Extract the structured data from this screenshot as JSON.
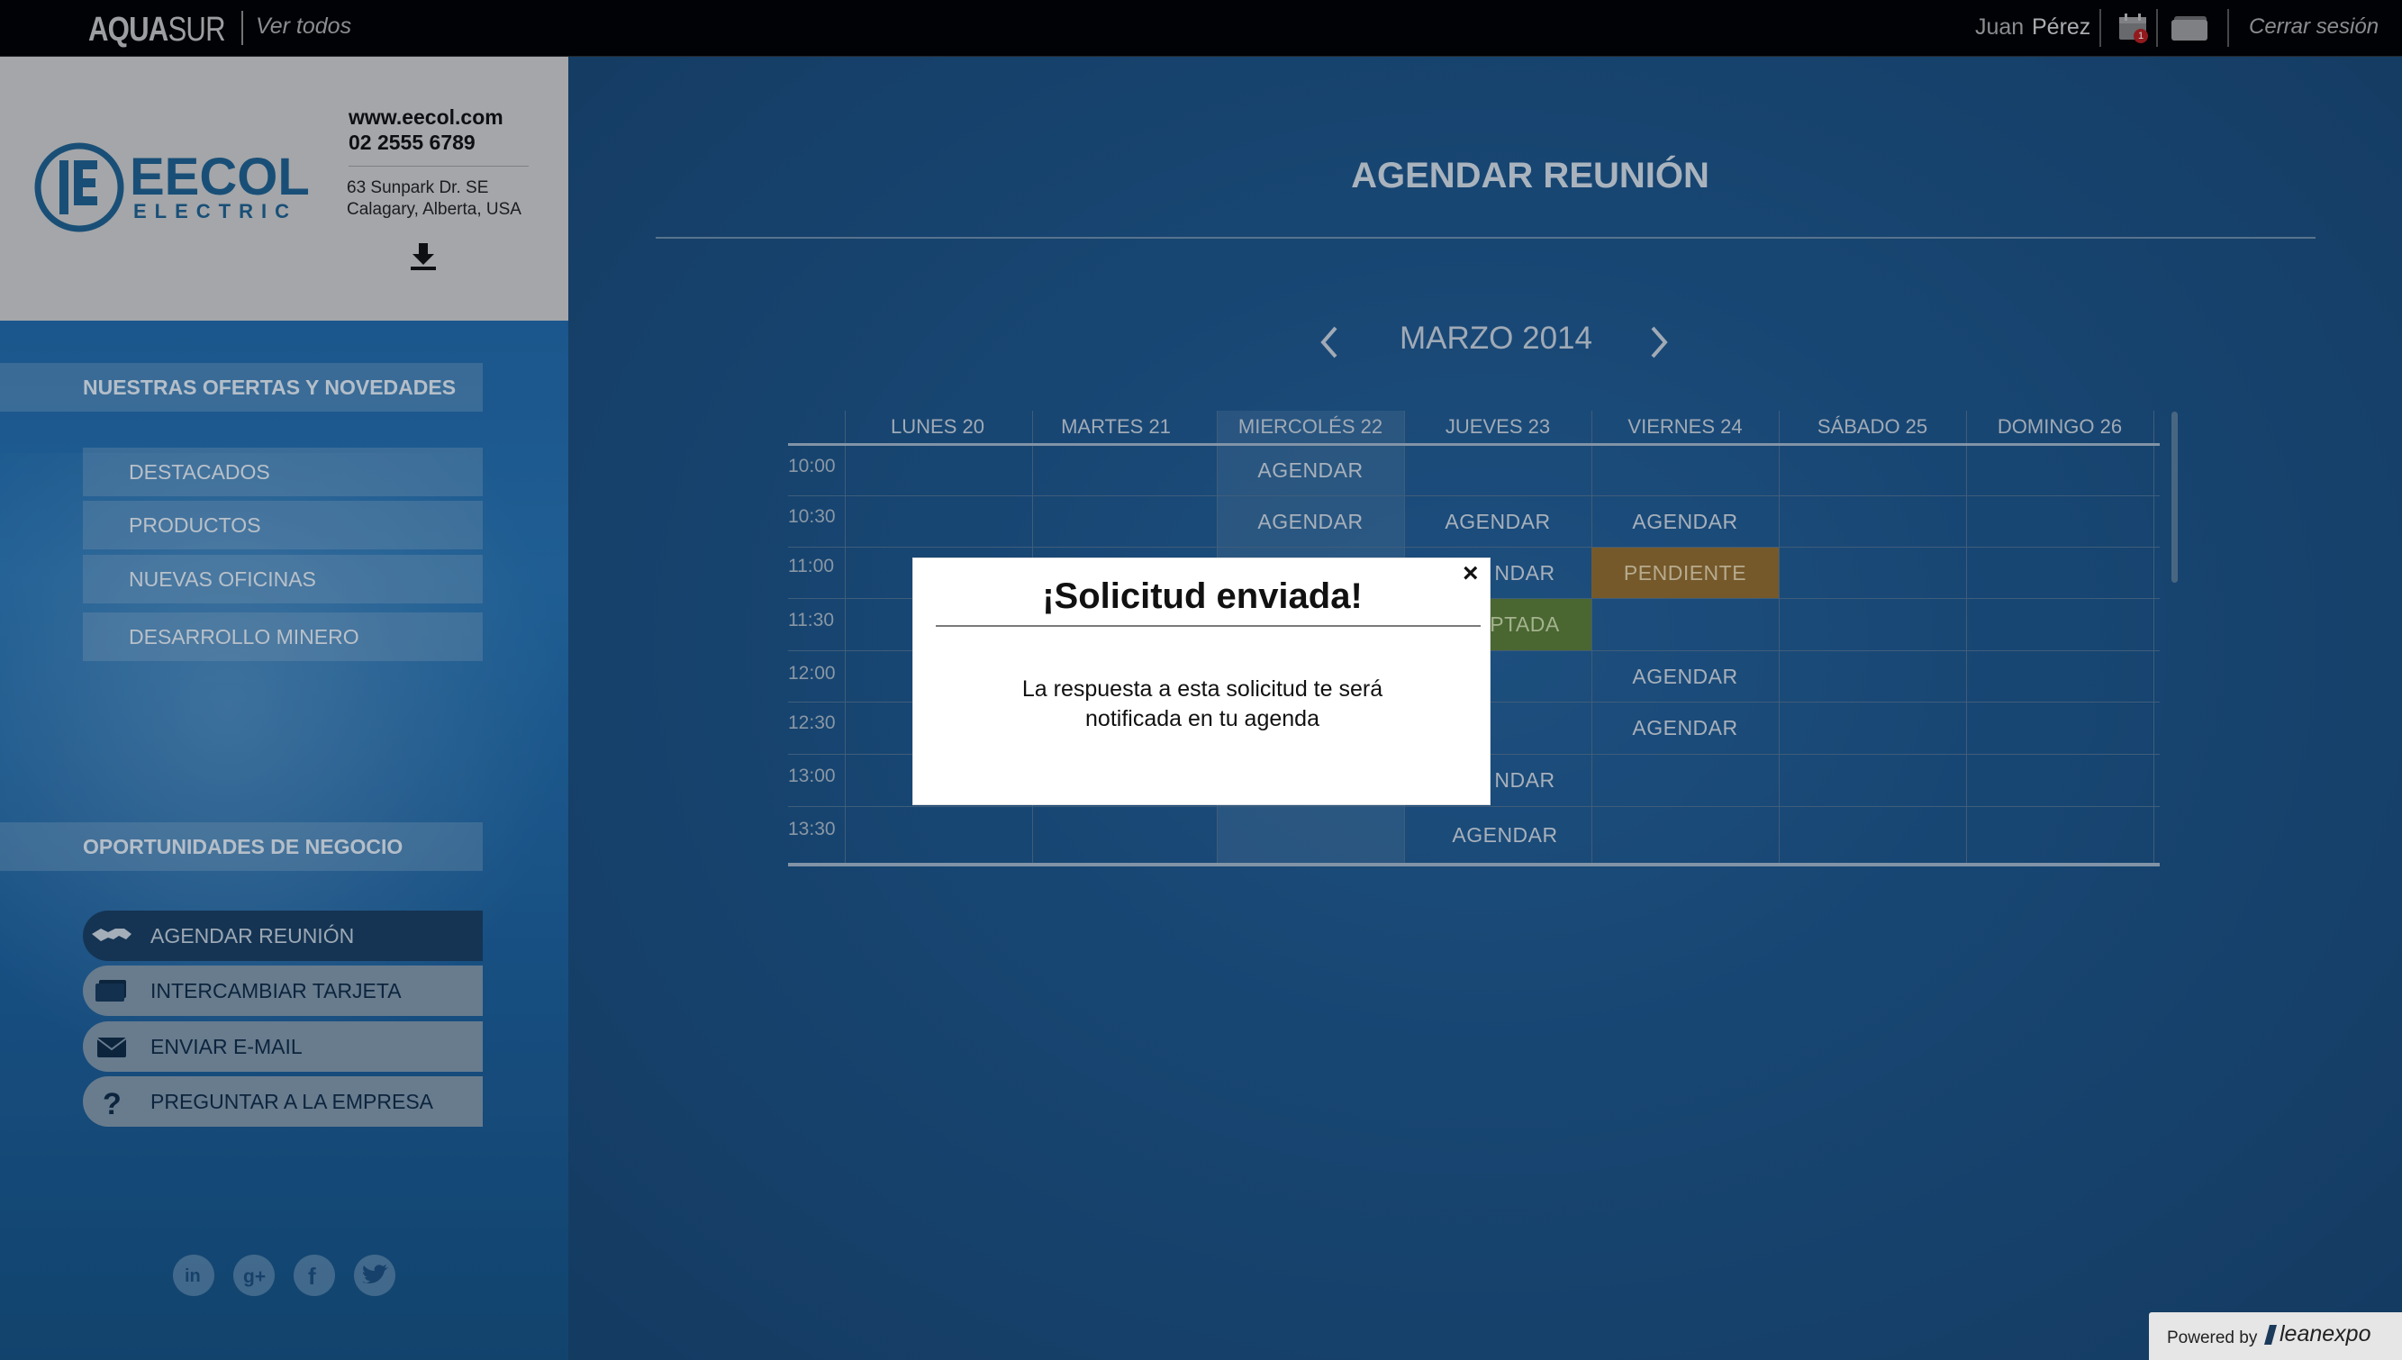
{
  "topbar": {
    "brand_bold": "AQUA",
    "brand_rest": "SUR",
    "ver_todos": "Ver todos",
    "user_first": "Juan",
    "user_last": "Pérez",
    "calendar_badge": "1",
    "logout": "Cerrar sesión"
  },
  "company": {
    "logo_name": "EECOL",
    "logo_sub": "ELECTRIC",
    "website": "www.eecol.com",
    "phone": "02 2555 6789",
    "address_line1": "63 Sunpark Dr. SE",
    "address_line2": "Calagary, Alberta, USA"
  },
  "sidebar": {
    "offers_header": "NUESTRAS OFERTAS Y NOVEDADES",
    "offers": [
      "DESTACADOS",
      "PRODUCTOS",
      "NUEVAS OFICINAS",
      "DESARROLLO MINERO"
    ],
    "business_header": "OPORTUNIDADES DE NEGOCIO",
    "actions": [
      {
        "label": "AGENDAR REUNIÓN",
        "icon": "handshake-icon",
        "active": true
      },
      {
        "label": "INTERCAMBIAR TARJETA",
        "icon": "card-icon",
        "active": false
      },
      {
        "label": "ENVIAR E-MAIL",
        "icon": "envelope-icon",
        "active": false
      },
      {
        "label": "PREGUNTAR A LA EMPRESA",
        "icon": "question-icon",
        "active": false
      }
    ],
    "social": [
      "linkedin-icon",
      "googleplus-icon",
      "facebook-icon",
      "twitter-icon"
    ]
  },
  "main": {
    "title": "AGENDAR REUNIÓN",
    "month": "MARZO 2014",
    "days": [
      "LUNES 20",
      "MARTES 21",
      "MIERCOLÉS 22",
      "JUEVES 23",
      "VIERNES 24",
      "SÁBADO 25",
      "DOMINGO 26"
    ],
    "hours": [
      "10:00",
      "10:30",
      "11:00",
      "11:30",
      "12:00",
      "12:30",
      "13:00",
      "13:30"
    ],
    "slots": {
      "wed_1000": "AGENDAR",
      "wed_1030": "AGENDAR",
      "thu_1030": "AGENDAR",
      "thu_1100": "NDAR",
      "thu_1130": "PTADA",
      "thu_1300": "NDAR",
      "thu_1330": "AGENDAR",
      "fri_1030": "AGENDAR",
      "fri_1100": "PENDIENTE",
      "fri_1200": "AGENDAR",
      "fri_1230": "AGENDAR"
    }
  },
  "modal": {
    "title": "¡Solicitud enviada!",
    "close": "×",
    "body_line1": "La respuesta a esta solicitud te será",
    "body_line2": "notificada en tu agenda"
  },
  "footer": {
    "powered_by": "Powered by",
    "brand": "leanexpo"
  },
  "colors": {
    "topbar": "#000000",
    "main_bg": "#1e5487",
    "pending": "#8f6b2f",
    "accepted": "#5b7b36"
  }
}
